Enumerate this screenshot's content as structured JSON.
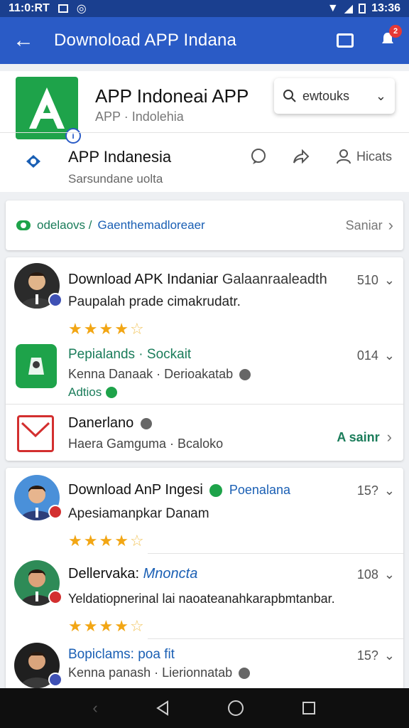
{
  "status_bar": {
    "time": "11:0:RT",
    "clock": "13:36"
  },
  "app_bar": {
    "title": "Downoload APP Indana",
    "notification_count": "2"
  },
  "header": {
    "app_name": "APP Indoneai APP",
    "app_subtitle": "APP · Indolehia",
    "search_text": "ewtouks",
    "row_title": "APP Indanesia",
    "row_subtitle": "Sarsundane uolta",
    "actions": {
      "share_label": "Hicats"
    }
  },
  "category": {
    "label_green": "odelaovs /",
    "label_blue": "Gaenthemadloreaer",
    "action": "Saniar"
  },
  "card_a": {
    "item1": {
      "title": "Download APK Indaniar",
      "extra": "Galaanraaleadth",
      "count": "510",
      "desc": "Paupalah prade cimakrudatr.",
      "rating": 4
    },
    "item2": {
      "title": "Pepialands · Sockait",
      "count": "014",
      "desc": "Kenna Danaak · Derioakatab",
      "tag": "Adtios"
    },
    "item3": {
      "title": "Danerlano",
      "desc": "Haera Gamguma · Bcaloko",
      "action": "A sainr"
    }
  },
  "card_b": {
    "item1": {
      "title": "Download AnP Ingesi",
      "link": "Poenalana",
      "count": "15?",
      "desc": "Apesiamanpkar Danam",
      "rating": 4
    },
    "item2": {
      "title": "Dellervaka:",
      "link": "Mnoncta",
      "count": "108",
      "desc": "Yeldatiopnerinal lai naoateanahkarapbmtanbar.",
      "rating": 4
    },
    "item3": {
      "title": "Bopiclams: poa fit",
      "count": "15?",
      "desc": "Kenna panash · Lierionnatab"
    }
  },
  "colors": {
    "app_bar": "#2a5bc6",
    "status_bar": "#1a3f8f",
    "accent_green": "#1ea34a",
    "star": "#f2a614"
  }
}
